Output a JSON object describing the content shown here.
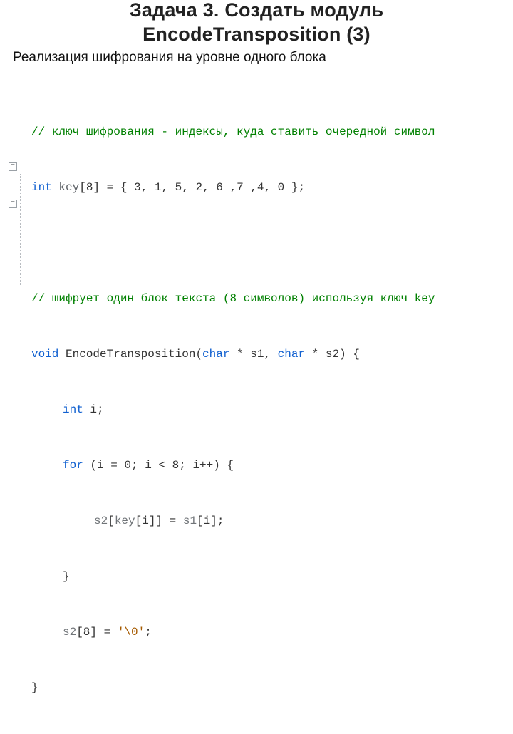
{
  "title_line1": "Задача 3. Создать модуль",
  "title_line2": "EncodeTransposition (3)",
  "subtitle": "Реализация шифрования на уровне одного блока",
  "code": {
    "comment1": "// ключ шифрования - индексы, куда ставить очередной символ",
    "kw_int_1": "int",
    "keyDecl_ident": "key",
    "keyDecl_rest": "[8] = { 3, 1, 5, 2, 6 ,7 ,4, 0 };",
    "comment2": "// шифрует один блок текста (8 символов) используя ключ key",
    "kw_void": "void",
    "fn_name": " EncodeTransposition(",
    "kw_char1": "char",
    "arg1": " * s1, ",
    "kw_char2": "char",
    "arg2": " * s2) {",
    "kw_int_2": "int",
    "var_i_decl": " i;",
    "kw_for": "for",
    "for_rest": " (i = 0; i < 8; i++) {",
    "stmt_s2": "s2",
    "stmt_mid1": "[",
    "stmt_key": "key",
    "stmt_mid2": "[i]] = ",
    "stmt_s1": "s1",
    "stmt_end": "[i];",
    "brace_close1": "}",
    "assign_s2": "s2",
    "assign_mid": "[8] = ",
    "char_lit": "'\\0'",
    "assign_end": ";",
    "brace_close2": "}"
  },
  "fold": {
    "minus": "−"
  }
}
